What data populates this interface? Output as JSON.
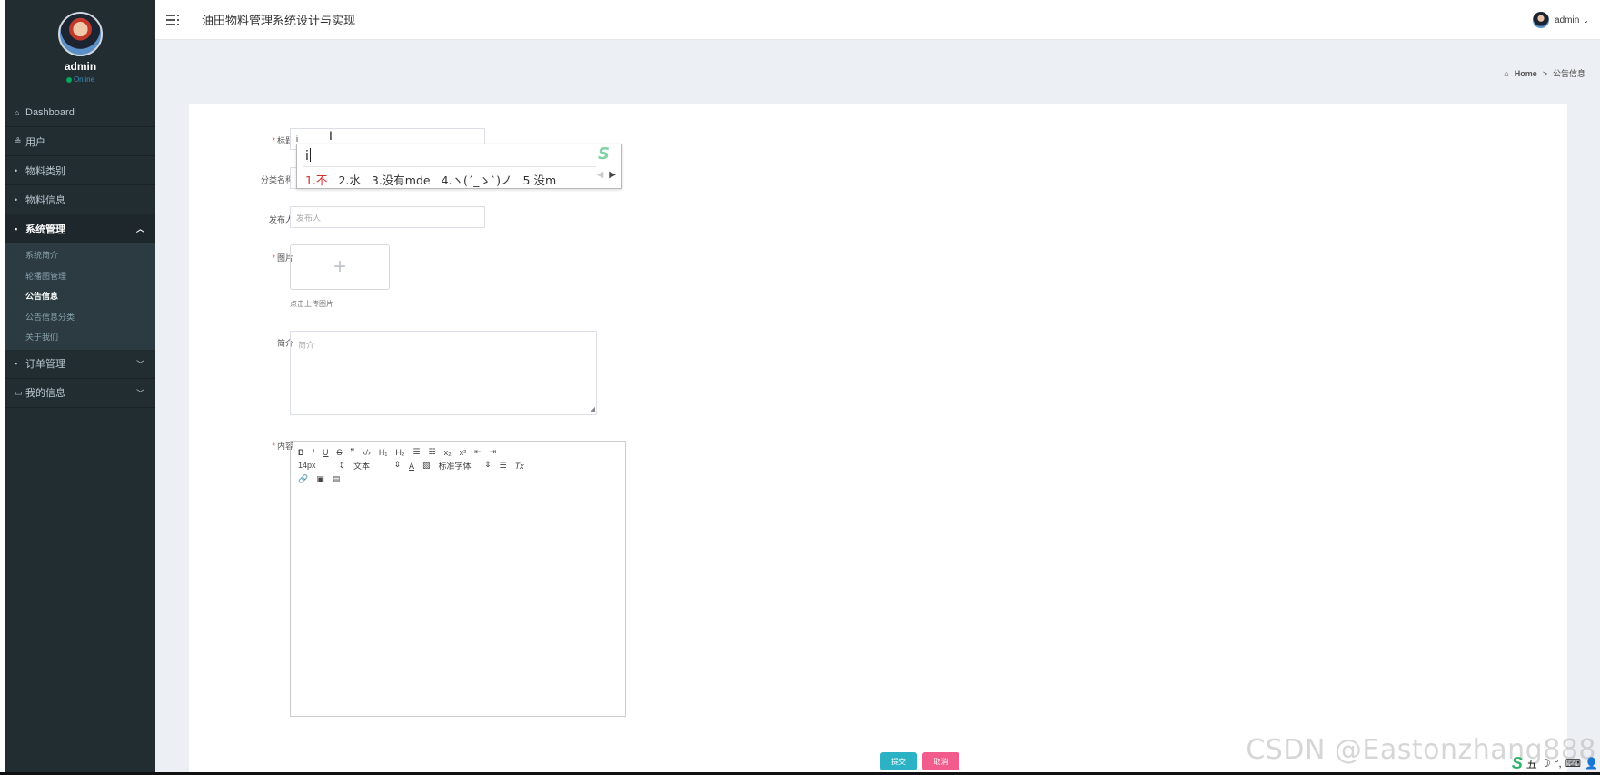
{
  "sidebar": {
    "username": "admin",
    "status": "Online",
    "items": [
      {
        "icon": "home-icon",
        "glyph": "⌂",
        "label": "Dashboard"
      },
      {
        "icon": "user-icon",
        "glyph": "≗",
        "label": "用户"
      },
      {
        "icon": "dot-icon",
        "glyph": "•",
        "label": "物料类别"
      },
      {
        "icon": "dot-icon",
        "glyph": "•",
        "label": "物料信息"
      },
      {
        "icon": "grid-icon",
        "glyph": "▪",
        "label": "系统管理"
      },
      {
        "icon": "grid-icon",
        "glyph": "▪",
        "label": "订单管理"
      },
      {
        "icon": "card-icon",
        "glyph": "▭",
        "label": "我的信息"
      }
    ],
    "submenu": [
      "系统简介",
      "轮播图管理",
      "公告信息",
      "公告信息分类",
      "关于我们"
    ]
  },
  "header": {
    "title": "油田物料管理系统设计与实现",
    "user": "admin"
  },
  "breadcrumb": {
    "home": "Home",
    "sep": ">",
    "current": "公告信息"
  },
  "form": {
    "title_label": "标题",
    "title_value": "i",
    "category_label": "分类名称",
    "publisher_label": "发布人",
    "publisher_placeholder": "发布人",
    "image_label": "图片",
    "upload_tip": "点击上传图片",
    "intro_label": "简介",
    "intro_placeholder": "简介",
    "content_label": "内容",
    "submit": "提交",
    "cancel": "取消"
  },
  "editor": {
    "row1": [
      "B",
      "I",
      "U",
      "S",
      "❞",
      "‹/›",
      "H₁",
      "H₂",
      "☰",
      "☷",
      "x₂",
      "x²",
      "⇤",
      "⇥"
    ],
    "font_size": "14px",
    "header_select": "文本",
    "font_select": "标准字体",
    "color_tool": "A",
    "bg_tool": "▧",
    "align_tool": "☰",
    "clear_tool": "Tx"
  },
  "ime": {
    "composition": "i",
    "candidates": [
      "1.不",
      "2.水",
      "3.没有mde",
      "4.ヽ(´_ゝ`)ノ",
      "5.没m"
    ]
  },
  "watermark": "CSDN @Eastonzhang888",
  "tray": {
    "ime_logo": "S",
    "items": [
      "五",
      "☽",
      "°,",
      "⌨",
      "👤"
    ]
  }
}
